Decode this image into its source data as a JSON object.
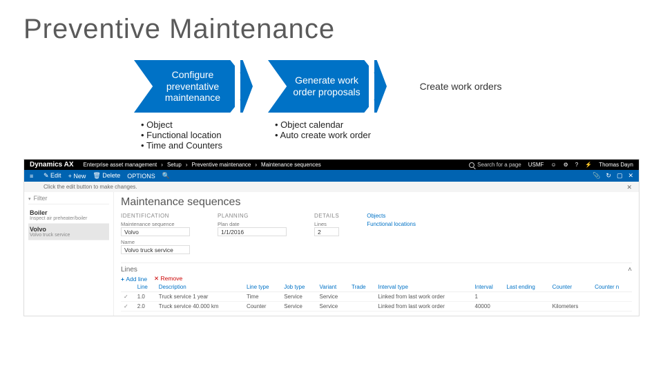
{
  "title": "Preventive Maintenance",
  "chevrons": [
    {
      "label": "Configure preventative maintenance",
      "style": "blue"
    },
    {
      "label": "Generate work order proposals",
      "style": "blue"
    },
    {
      "label": "Create work orders",
      "style": "light"
    }
  ],
  "bullets": {
    "col1": [
      "Object",
      "Functional location",
      "Time and Counters"
    ],
    "col2": [
      "Object calendar",
      "Auto create work order"
    ]
  },
  "dynamics": {
    "product": "Dynamics AX",
    "crumbs": [
      "Enterprise asset management",
      "Setup",
      "Preventive maintenance",
      "Maintenance sequences"
    ],
    "search_placeholder": "Search for a page",
    "company": "USMF",
    "user": "Thomas Dayn",
    "ribbon": {
      "edit": "Edit",
      "new": "New",
      "delete": "Delete",
      "options": "OPTIONS"
    },
    "info": "Click the edit button to make changes.",
    "filter_placeholder": "Filter",
    "side": [
      {
        "name": "Boiler",
        "sub": "Inspect air preheater/boiler"
      },
      {
        "name": "Volvo",
        "sub": "Volvo truck service"
      }
    ],
    "page_title": "Maintenance sequences",
    "groups": {
      "identification": "IDENTIFICATION",
      "planning": "PLANNING",
      "details": "DETAILS"
    },
    "fields": {
      "maint_seq_label": "Maintenance sequence",
      "maint_seq_val": "Volvo",
      "name_label": "Name",
      "name_val": "Volvo truck service",
      "plan_date_label": "Plan date",
      "plan_date_val": "1/1/2016",
      "lines_count_label": "Lines",
      "lines_count_val": "2"
    },
    "links": {
      "objects": "Objects",
      "func_loc": "Functional locations"
    },
    "lines": {
      "title": "Lines",
      "add": "Add line",
      "remove": "Remove",
      "columns": [
        "",
        "Line",
        "Description",
        "Line type",
        "Job type",
        "Variant",
        "Trade",
        "Interval type",
        "Interval",
        "Last ending",
        "Counter",
        "Counter n"
      ],
      "rows": [
        {
          "line": "1.0",
          "desc": "Truck service 1 year",
          "linetype": "Time",
          "jobtype": "Service",
          "variant": "Service",
          "trade": "",
          "intervaltype": "Linked from last work order",
          "interval": "1",
          "lastending": "",
          "counter": "",
          "countern": ""
        },
        {
          "line": "2.0",
          "desc": "Truck service 40.000 km",
          "linetype": "Counter",
          "jobtype": "Service",
          "variant": "Service",
          "trade": "",
          "intervaltype": "Linked from last work order",
          "interval": "40000",
          "lastending": "",
          "counter": "Kilometers",
          "countern": ""
        }
      ]
    }
  }
}
